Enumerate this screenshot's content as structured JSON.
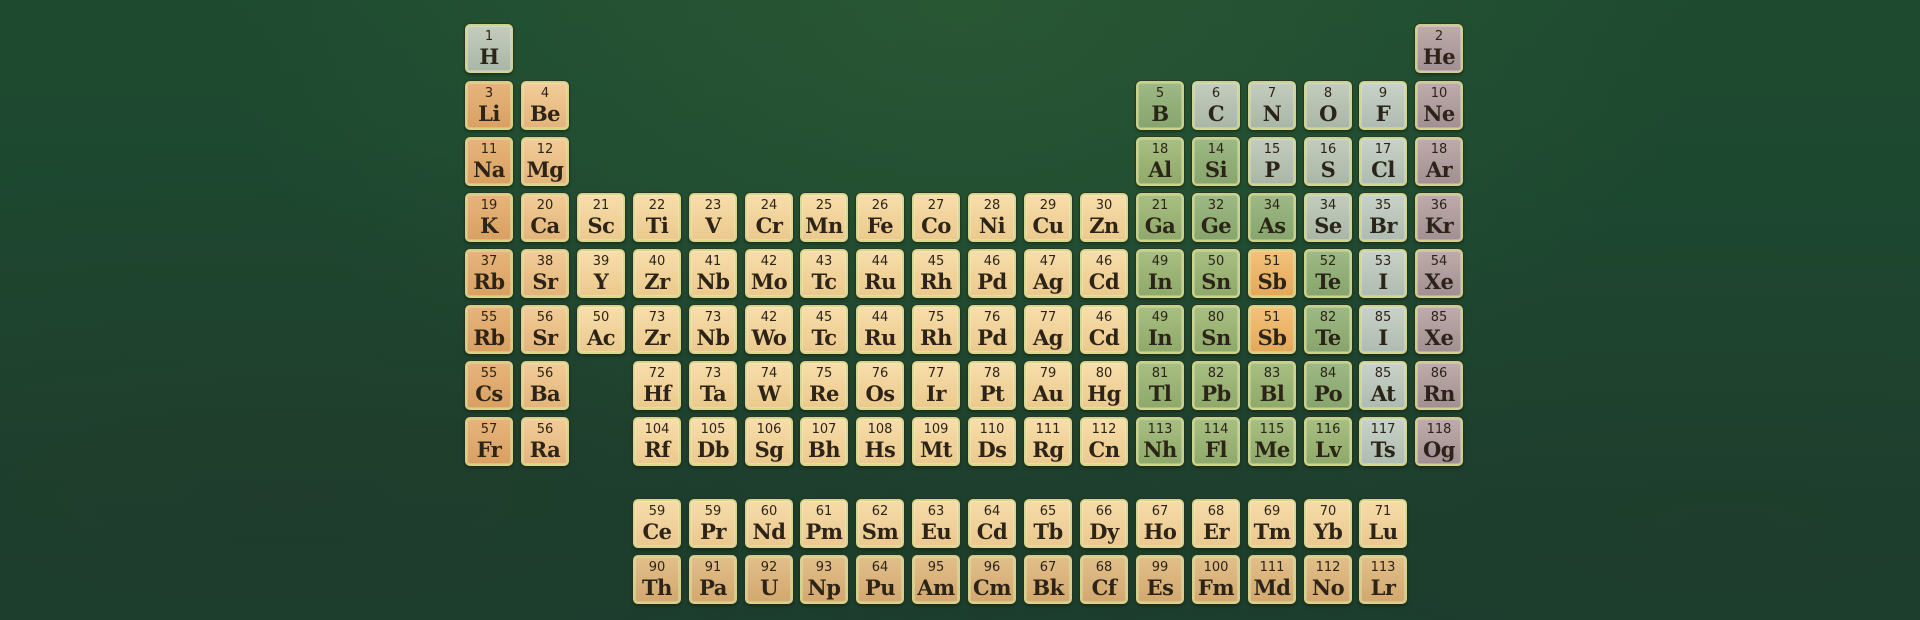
{
  "table": {
    "rows": [
      [
        {
          "n": "1",
          "s": "H",
          "t": "nm"
        },
        null,
        null,
        null,
        null,
        null,
        null,
        null,
        null,
        null,
        null,
        null,
        null,
        null,
        null,
        null,
        null,
        {
          "n": "2",
          "s": "He",
          "t": "ng"
        }
      ],
      [
        {
          "n": "3",
          "s": "Li",
          "t": "alk"
        },
        {
          "n": "4",
          "s": "Be",
          "t": "ae"
        },
        null,
        null,
        null,
        null,
        null,
        null,
        null,
        null,
        null,
        null,
        {
          "n": "5",
          "s": "B",
          "t": "ml"
        },
        {
          "n": "6",
          "s": "C",
          "t": "nm"
        },
        {
          "n": "7",
          "s": "N",
          "t": "nm"
        },
        {
          "n": "8",
          "s": "O",
          "t": "nm"
        },
        {
          "n": "9",
          "s": "F",
          "t": "hal"
        },
        {
          "n": "10",
          "s": "Ne",
          "t": "ng"
        }
      ],
      [
        {
          "n": "11",
          "s": "Na",
          "t": "alk"
        },
        {
          "n": "12",
          "s": "Mg",
          "t": "ae"
        },
        null,
        null,
        null,
        null,
        null,
        null,
        null,
        null,
        null,
        null,
        {
          "n": "18",
          "s": "Al",
          "t": "pt"
        },
        {
          "n": "14",
          "s": "Si",
          "t": "ml"
        },
        {
          "n": "15",
          "s": "P",
          "t": "nm"
        },
        {
          "n": "16",
          "s": "S",
          "t": "nm"
        },
        {
          "n": "17",
          "s": "Cl",
          "t": "hal"
        },
        {
          "n": "18",
          "s": "Ar",
          "t": "ng"
        }
      ],
      [
        {
          "n": "19",
          "s": "K",
          "t": "alk"
        },
        {
          "n": "20",
          "s": "Ca",
          "t": "ae"
        },
        {
          "n": "21",
          "s": "Sc",
          "t": "tm"
        },
        {
          "n": "22",
          "s": "Ti",
          "t": "tm"
        },
        {
          "n": "23",
          "s": "V",
          "t": "tm"
        },
        {
          "n": "24",
          "s": "Cr",
          "t": "tm"
        },
        {
          "n": "25",
          "s": "Mn",
          "t": "tm"
        },
        {
          "n": "26",
          "s": "Fe",
          "t": "tm"
        },
        {
          "n": "27",
          "s": "Co",
          "t": "tm"
        },
        {
          "n": "28",
          "s": "Ni",
          "t": "tm"
        },
        {
          "n": "29",
          "s": "Cu",
          "t": "tm"
        },
        {
          "n": "30",
          "s": "Zn",
          "t": "tm"
        },
        {
          "n": "21",
          "s": "Ga",
          "t": "pt"
        },
        {
          "n": "32",
          "s": "Ge",
          "t": "ml"
        },
        {
          "n": "34",
          "s": "As",
          "t": "ml"
        },
        {
          "n": "34",
          "s": "Se",
          "t": "nm"
        },
        {
          "n": "35",
          "s": "Br",
          "t": "hal"
        },
        {
          "n": "36",
          "s": "Kr",
          "t": "ng"
        }
      ],
      [
        {
          "n": "37",
          "s": "Rb",
          "t": "alk"
        },
        {
          "n": "38",
          "s": "Sr",
          "t": "ae"
        },
        {
          "n": "39",
          "s": "Y",
          "t": "tm"
        },
        {
          "n": "40",
          "s": "Zr",
          "t": "tm"
        },
        {
          "n": "41",
          "s": "Nb",
          "t": "tm"
        },
        {
          "n": "42",
          "s": "Mo",
          "t": "tm"
        },
        {
          "n": "43",
          "s": "Tc",
          "t": "tm"
        },
        {
          "n": "44",
          "s": "Ru",
          "t": "tm"
        },
        {
          "n": "45",
          "s": "Rh",
          "t": "tm"
        },
        {
          "n": "46",
          "s": "Pd",
          "t": "tm"
        },
        {
          "n": "47",
          "s": "Ag",
          "t": "tm"
        },
        {
          "n": "46",
          "s": "Cd",
          "t": "tm"
        },
        {
          "n": "49",
          "s": "In",
          "t": "pt"
        },
        {
          "n": "50",
          "s": "Sn",
          "t": "pt"
        },
        {
          "n": "51",
          "s": "Sb",
          "t": "hl"
        },
        {
          "n": "52",
          "s": "Te",
          "t": "ml"
        },
        {
          "n": "53",
          "s": "I",
          "t": "hal"
        },
        {
          "n": "54",
          "s": "Xe",
          "t": "ng"
        }
      ],
      [
        {
          "n": "55",
          "s": "Rb",
          "t": "alk"
        },
        {
          "n": "56",
          "s": "Sr",
          "t": "ae"
        },
        {
          "n": "50",
          "s": "Ac",
          "t": "tm"
        },
        {
          "n": "73",
          "s": "Zr",
          "t": "tm"
        },
        {
          "n": "73",
          "s": "Nb",
          "t": "tm"
        },
        {
          "n": "42",
          "s": "Wo",
          "t": "tm"
        },
        {
          "n": "45",
          "s": "Tc",
          "t": "tm"
        },
        {
          "n": "44",
          "s": "Ru",
          "t": "tm"
        },
        {
          "n": "75",
          "s": "Rh",
          "t": "tm"
        },
        {
          "n": "76",
          "s": "Pd",
          "t": "tm"
        },
        {
          "n": "77",
          "s": "Ag",
          "t": "tm"
        },
        {
          "n": "46",
          "s": "Cd",
          "t": "tm"
        },
        {
          "n": "49",
          "s": "In",
          "t": "pt"
        },
        {
          "n": "80",
          "s": "Sn",
          "t": "pt"
        },
        {
          "n": "51",
          "s": "Sb",
          "t": "hl"
        },
        {
          "n": "82",
          "s": "Te",
          "t": "ml"
        },
        {
          "n": "85",
          "s": "I",
          "t": "hal"
        },
        {
          "n": "85",
          "s": "Xe",
          "t": "ng"
        }
      ],
      [
        {
          "n": "55",
          "s": "Cs",
          "t": "alk"
        },
        {
          "n": "56",
          "s": "Ba",
          "t": "ae"
        },
        null,
        {
          "n": "72",
          "s": "Hf",
          "t": "tm"
        },
        {
          "n": "73",
          "s": "Ta",
          "t": "tm"
        },
        {
          "n": "74",
          "s": "W",
          "t": "tm"
        },
        {
          "n": "75",
          "s": "Re",
          "t": "tm"
        },
        {
          "n": "76",
          "s": "Os",
          "t": "tm"
        },
        {
          "n": "77",
          "s": "Ir",
          "t": "tm"
        },
        {
          "n": "78",
          "s": "Pt",
          "t": "tm"
        },
        {
          "n": "79",
          "s": "Au",
          "t": "tm"
        },
        {
          "n": "80",
          "s": "Hg",
          "t": "tm"
        },
        {
          "n": "81",
          "s": "Tl",
          "t": "pt"
        },
        {
          "n": "82",
          "s": "Pb",
          "t": "pt"
        },
        {
          "n": "83",
          "s": "Bl",
          "t": "pt"
        },
        {
          "n": "84",
          "s": "Po",
          "t": "ml"
        },
        {
          "n": "85",
          "s": "At",
          "t": "hal"
        },
        {
          "n": "86",
          "s": "Rn",
          "t": "ng"
        }
      ],
      [
        {
          "n": "57",
          "s": "Fr",
          "t": "alk"
        },
        {
          "n": "56",
          "s": "Ra",
          "t": "ae"
        },
        null,
        {
          "n": "104",
          "s": "Rf",
          "t": "tm"
        },
        {
          "n": "105",
          "s": "Db",
          "t": "tm"
        },
        {
          "n": "106",
          "s": "Sg",
          "t": "tm"
        },
        {
          "n": "107",
          "s": "Bh",
          "t": "tm"
        },
        {
          "n": "108",
          "s": "Hs",
          "t": "tm"
        },
        {
          "n": "109",
          "s": "Mt",
          "t": "tm"
        },
        {
          "n": "110",
          "s": "Ds",
          "t": "tm"
        },
        {
          "n": "111",
          "s": "Rg",
          "t": "tm"
        },
        {
          "n": "112",
          "s": "Cn",
          "t": "tm"
        },
        {
          "n": "113",
          "s": "Nh",
          "t": "pt"
        },
        {
          "n": "114",
          "s": "Fl",
          "t": "pt"
        },
        {
          "n": "115",
          "s": "Me",
          "t": "pt"
        },
        {
          "n": "116",
          "s": "Lv",
          "t": "pt"
        },
        {
          "n": "117",
          "s": "Ts",
          "t": "hal"
        },
        {
          "n": "118",
          "s": "Og",
          "t": "ng"
        }
      ]
    ],
    "lanthanides": [
      {
        "n": "59",
        "s": "Ce",
        "t": "lan"
      },
      {
        "n": "59",
        "s": "Pr",
        "t": "lan"
      },
      {
        "n": "60",
        "s": "Nd",
        "t": "lan"
      },
      {
        "n": "61",
        "s": "Pm",
        "t": "lan"
      },
      {
        "n": "62",
        "s": "Sm",
        "t": "lan"
      },
      {
        "n": "63",
        "s": "Eu",
        "t": "lan"
      },
      {
        "n": "64",
        "s": "Cd",
        "t": "lan"
      },
      {
        "n": "65",
        "s": "Tb",
        "t": "lan"
      },
      {
        "n": "66",
        "s": "Dy",
        "t": "lan"
      },
      {
        "n": "67",
        "s": "Ho",
        "t": "lan"
      },
      {
        "n": "68",
        "s": "Er",
        "t": "lan"
      },
      {
        "n": "69",
        "s": "Tm",
        "t": "lan"
      },
      {
        "n": "70",
        "s": "Yb",
        "t": "lan"
      },
      {
        "n": "71",
        "s": "Lu",
        "t": "lan"
      }
    ],
    "actinides": [
      {
        "n": "90",
        "s": "Th",
        "t": "act"
      },
      {
        "n": "91",
        "s": "Pa",
        "t": "act"
      },
      {
        "n": "92",
        "s": "U",
        "t": "act"
      },
      {
        "n": "93",
        "s": "Np",
        "t": "act"
      },
      {
        "n": "64",
        "s": "Pu",
        "t": "act"
      },
      {
        "n": "95",
        "s": "Am",
        "t": "act"
      },
      {
        "n": "96",
        "s": "Cm",
        "t": "act"
      },
      {
        "n": "67",
        "s": "Bk",
        "t": "act"
      },
      {
        "n": "68",
        "s": "Cf",
        "t": "act"
      },
      {
        "n": "99",
        "s": "Es",
        "t": "act"
      },
      {
        "n": "100",
        "s": "Fm",
        "t": "act"
      },
      {
        "n": "111",
        "s": "Md",
        "t": "act"
      },
      {
        "n": "112",
        "s": "No",
        "t": "act"
      },
      {
        "n": "113",
        "s": "Lr",
        "t": "act"
      }
    ]
  },
  "colors": {
    "background": "#1f4a30",
    "tile_border": "#d2d78c",
    "alkali_metal": "#e0aa6d",
    "alkaline_earth": "#ebc28a",
    "transition_metal": "#f2d49d",
    "post_transition": "#9cb476",
    "metalloid": "#93af79",
    "nonmetal": "#b7c2b1",
    "halogen": "#bcc7bc",
    "noble_gas": "#b09d9f",
    "highlight": "#ebb66a",
    "lanthanide": "#f1d29c",
    "actinide": "#dab47c"
  }
}
